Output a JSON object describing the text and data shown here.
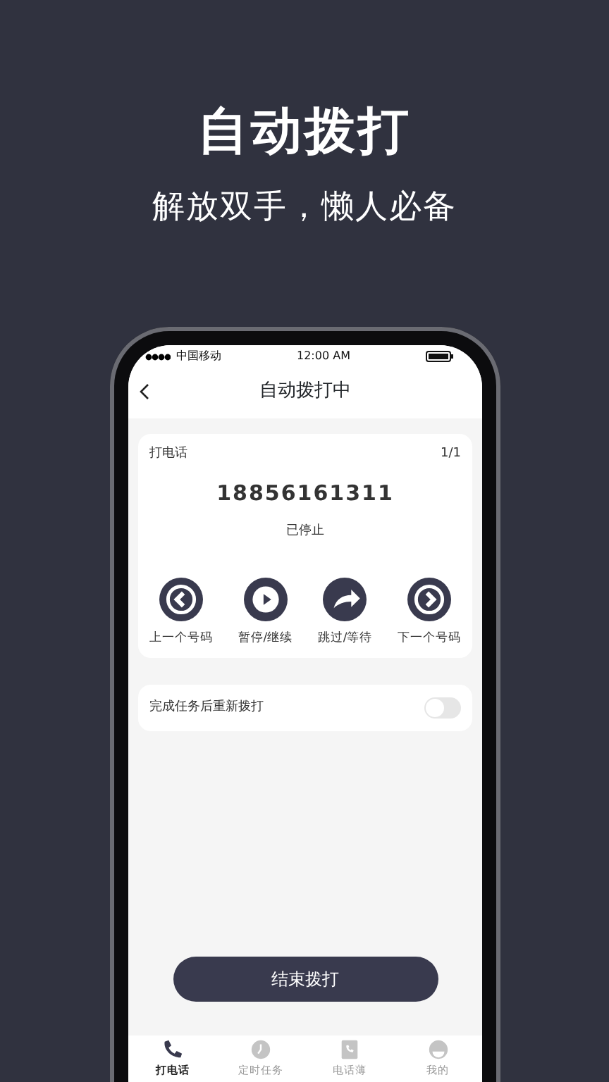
{
  "headline": "自动拨打",
  "subtitle": "解放双手，懒人必备",
  "status_bar": {
    "carrier": "中国移动",
    "time": "12:00 AM"
  },
  "nav": {
    "title": "自动拨打中"
  },
  "call_card": {
    "label": "打电话",
    "counter": "1/1",
    "number": "18856161311",
    "status": "已停止",
    "controls": [
      {
        "kind": "prev",
        "label": "上一个号码"
      },
      {
        "kind": "pause",
        "label": "暂停/继续"
      },
      {
        "kind": "skip",
        "label": "跳过/等待"
      },
      {
        "kind": "next",
        "label": "下一个号码"
      }
    ]
  },
  "redial": {
    "label": "完成任务后重新拨打",
    "on": false
  },
  "end_button": "结束拨打",
  "tabs": [
    {
      "kind": "call",
      "label": "打电话",
      "selected": true
    },
    {
      "kind": "timer",
      "label": "定时任务",
      "selected": false
    },
    {
      "kind": "contacts",
      "label": "电话薄",
      "selected": false
    },
    {
      "kind": "profile",
      "label": "我的",
      "selected": false
    }
  ]
}
